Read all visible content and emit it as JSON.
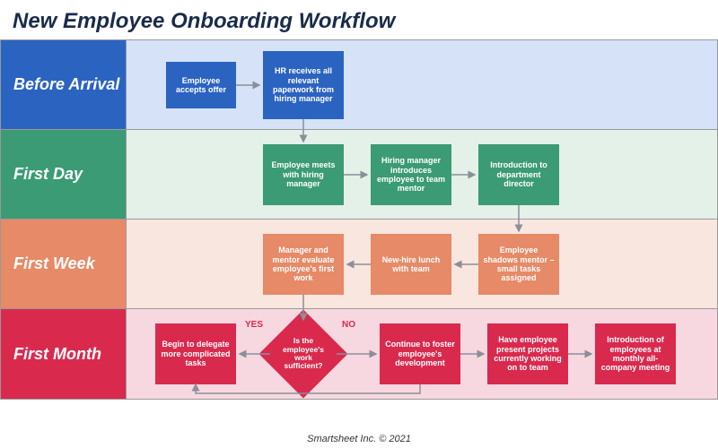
{
  "title": "New Employee Onboarding Workflow",
  "footer": "Smartsheet Inc. © 2021",
  "rows": {
    "r0": "Before Arrival",
    "r1": "First Day",
    "r2": "First Week",
    "r3": "First Month"
  },
  "nodes": {
    "n_accept": "Employee accepts offer",
    "n_hr": "HR receives all relevant paperwork from hiring manager",
    "n_meet": "Employee meets with hiring manager",
    "n_mentor": "Hiring manager introduces employee to team mentor",
    "n_director": "Introduction to department director",
    "n_shadow": "Employee shadows mentor – small tasks assigned",
    "n_lunch": "New-hire lunch with team",
    "n_eval": "Manager and mentor evaluate employee's first work",
    "n_delegate": "Begin to delegate more complicated tasks",
    "n_decision": "Is the employee's work sufficient?",
    "n_foster": "Continue to foster employee's development",
    "n_present": "Have employee present projects currently working on to team",
    "n_intro": "Introduction of employees at monthly all-company meeting"
  },
  "tags": {
    "yes": "YES",
    "no": "NO"
  }
}
